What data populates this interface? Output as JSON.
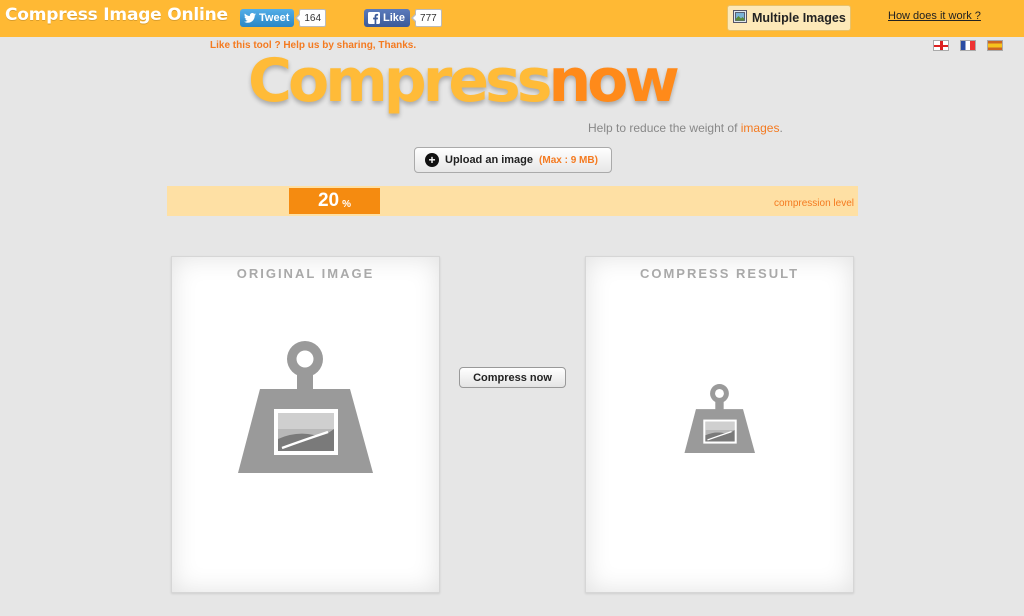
{
  "header": {
    "title": "Compress Image Online",
    "tweet_label": "Tweet",
    "tweet_count": "164",
    "like_label": "Like",
    "like_count": "777",
    "multiple_images_label": "Multiple Images",
    "how_link": "How does it work ?"
  },
  "languages": [
    "en",
    "fr",
    "es"
  ],
  "hero": {
    "share_hint": "Like this tool ? Help us by sharing, Thanks.",
    "logo_part1": "Compress",
    "logo_part2": "now",
    "tagline_prefix": "Help to reduce the weight of ",
    "tagline_highlight": "images",
    "tagline_suffix": "."
  },
  "upload": {
    "label": "Upload an image",
    "limit": "(Max : 9 MB)"
  },
  "compression": {
    "value": "20",
    "unit": "%",
    "label": "compression level"
  },
  "panels": {
    "original_title": "ORIGINAL IMAGE",
    "result_title": "COMPRESS RESULT"
  },
  "actions": {
    "compress_label": "Compress now"
  },
  "colors": {
    "header_bg": "#ffb934",
    "accent": "#f47a20",
    "level_bar": "#fee0a4",
    "level_handle": "#f58b10",
    "weight_icon": "#9a9a9a"
  }
}
